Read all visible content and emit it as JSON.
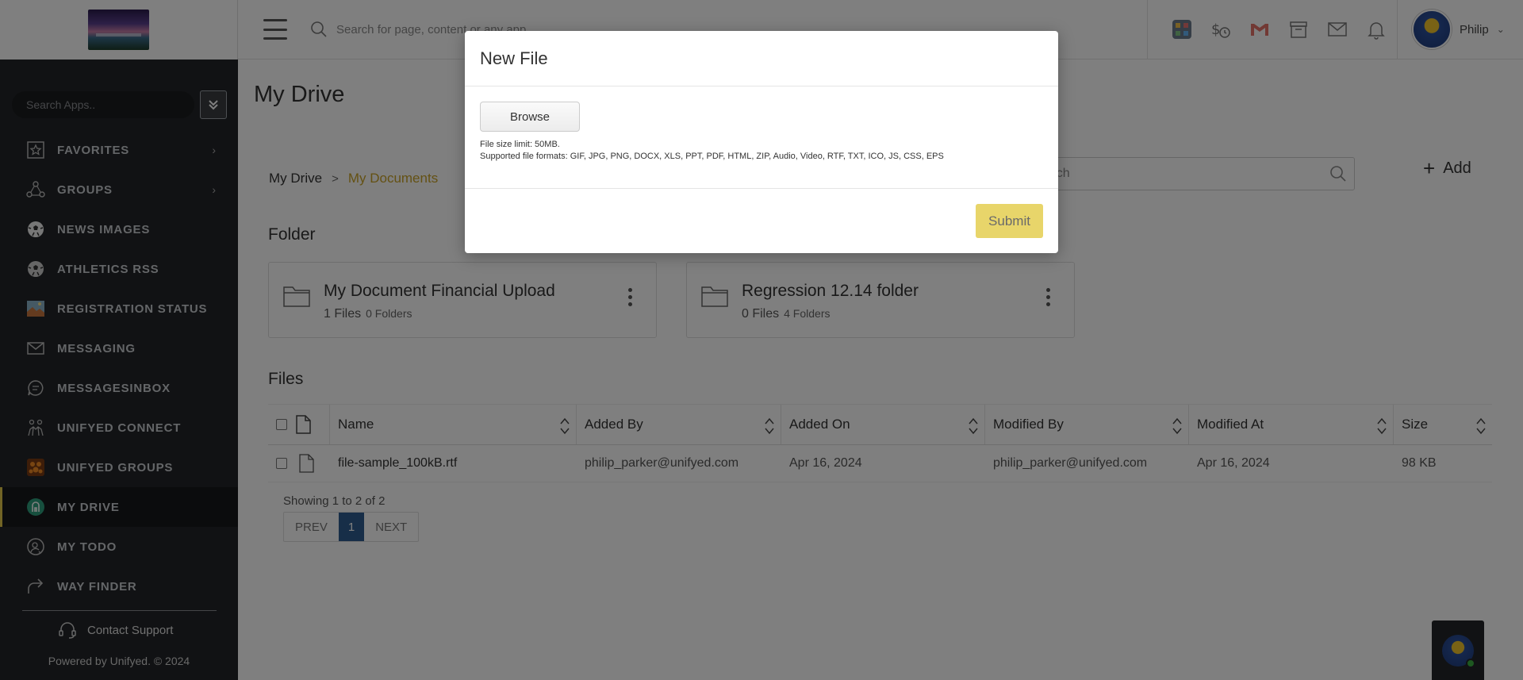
{
  "header": {
    "search_placeholder": "Search for page, content or any app",
    "user_name": "Philip",
    "icons": [
      "apps-grid-icon",
      "finance-icon",
      "gmail-icon",
      "archive-icon",
      "mail-icon",
      "bell-icon"
    ]
  },
  "sidebar": {
    "search_placeholder": "Search Apps..",
    "items": [
      {
        "label": "FAVORITES",
        "icon": "star-icon",
        "has_chevron": true
      },
      {
        "label": "GROUPS",
        "icon": "groups-icon",
        "has_chevron": true
      },
      {
        "label": "NEWS IMAGES",
        "icon": "soccer-ball-icon"
      },
      {
        "label": "ATHLETICS RSS",
        "icon": "soccer-ball-icon"
      },
      {
        "label": "REGISTRATION STATUS",
        "icon": "landscape-image-icon"
      },
      {
        "label": "MESSAGING",
        "icon": "envelope-icon"
      },
      {
        "label": "MESSAGESINBOX",
        "icon": "chat-bubble-icon"
      },
      {
        "label": "UNIFYED CONNECT",
        "icon": "people-connect-icon"
      },
      {
        "label": "UNIFYED GROUPS",
        "icon": "groups-orange-icon"
      },
      {
        "label": "MY DRIVE",
        "icon": "drive-icon",
        "active": true
      },
      {
        "label": "MY TODO",
        "icon": "todo-icon"
      },
      {
        "label": "WAY FINDER",
        "icon": "share-arrow-icon"
      }
    ],
    "contact_support": "Contact Support",
    "powered_by": "Powered by Unifyed. © 2024"
  },
  "main": {
    "title": "My Drive",
    "breadcrumb": {
      "home": "My Drive",
      "current": "My Documents"
    },
    "search_placeholder": "Search",
    "add_label": "Add",
    "folder_section": "Folder",
    "folders": [
      {
        "name": "My Document Financial Upload",
        "files": "1 Files",
        "folders": "0 Folders"
      },
      {
        "name": "Regression 12.14 folder",
        "files": "0 Files",
        "folders": "4 Folders"
      }
    ],
    "files_section": "Files",
    "table": {
      "columns": [
        "Name",
        "Added By",
        "Added On",
        "Modified By",
        "Modified At",
        "Size"
      ],
      "rows": [
        {
          "name": "file-sample_100kB.rtf",
          "added_by": "philip_parker@unifyed.com",
          "added_on": "Apr 16, 2024",
          "modified_by": "philip_parker@unifyed.com",
          "modified_at": "Apr 16, 2024",
          "size": "98 KB"
        }
      ]
    },
    "showing": "Showing 1 to 2 of 2",
    "pager": {
      "prev": "PREV",
      "page": "1",
      "next": "NEXT"
    }
  },
  "modal": {
    "title": "New File",
    "browse_label": "Browse",
    "size_limit": "File size limit: 50MB.",
    "formats": "Supported file formats: GIF, JPG, PNG, DOCX, XLS, PPT, PDF, HTML, ZIP, Audio, Video, RTF, TXT, ICO, JS, CSS, EPS",
    "submit_label": "Submit"
  },
  "colors": {
    "accent": "#e3c84a",
    "breadcrumb_current": "#c9a227",
    "sidebar_bg": "#232528",
    "pager_active": "#2f5d91",
    "submit_bg": "#e8d56a"
  }
}
